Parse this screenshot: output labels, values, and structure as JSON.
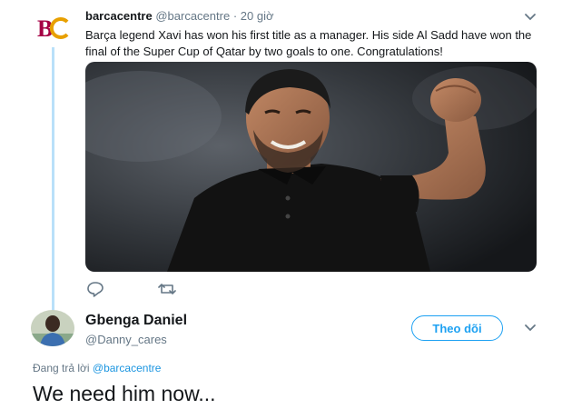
{
  "original_tweet": {
    "display_name": "barcacentre",
    "handle": "@barcacentre",
    "separator": "·",
    "time": "20 giờ",
    "text": "Barça legend Xavi has won his first title as a manager. His side Al Sadd have won the final of the Super Cup of Qatar by two goals to one. Congratulations!",
    "avatar_icon": "barcacentre-logo-icon",
    "actions": [
      "reply-icon",
      "retweet-icon"
    ]
  },
  "reply": {
    "display_name": "Gbenga Daniel",
    "handle": "@Danny_cares",
    "follow_label": "Theo dõi",
    "replying_prefix": "Đang trả lời",
    "replying_to": "@barcacentre",
    "text": "We need him now..."
  },
  "colors": {
    "accent": "#1da1f2",
    "link": "#1b95e0",
    "muted": "#657786",
    "thread_line": "#b9e0f9"
  }
}
